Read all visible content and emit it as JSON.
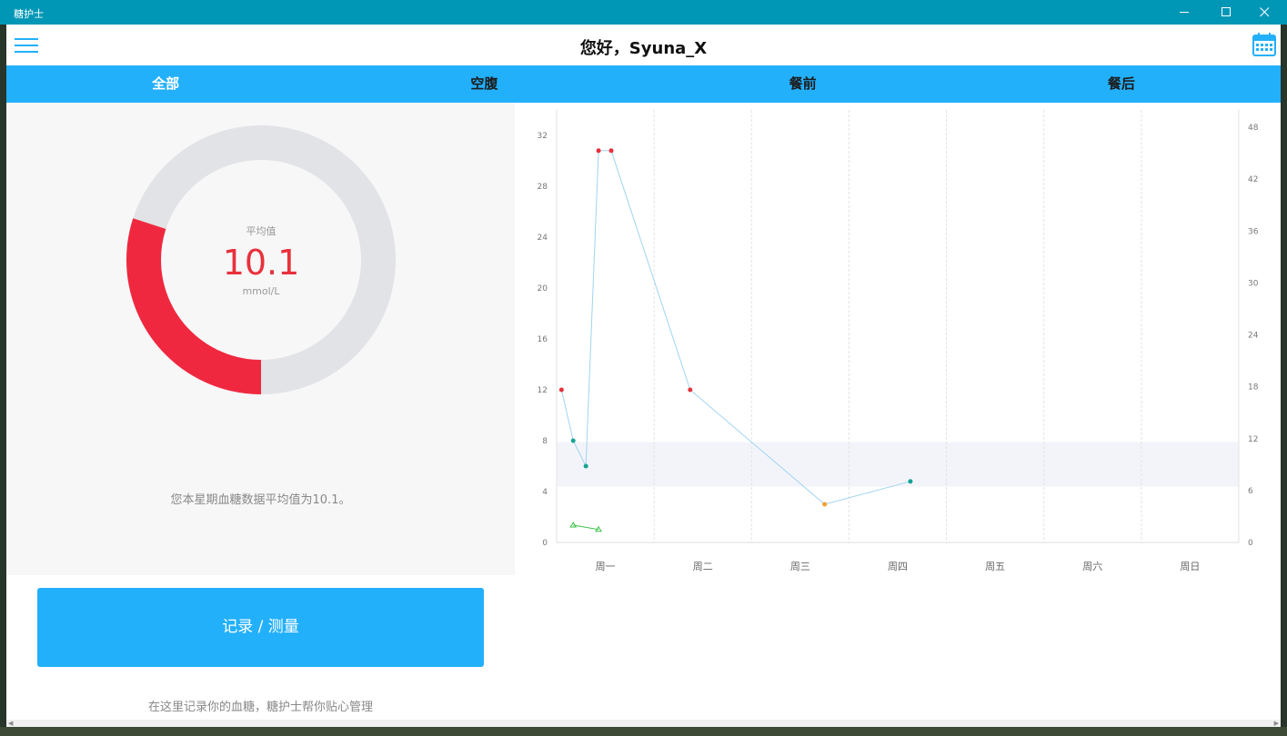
{
  "window": {
    "title": "糖护士",
    "controls": {
      "minimize_icon": "minimize-icon",
      "maximize_icon": "maximize-icon",
      "close_icon": "close-icon"
    }
  },
  "header": {
    "greeting": "您好，Syuna_X",
    "menu_icon": "hamburger-icon",
    "calendar_icon": "calendar-icon"
  },
  "tabs": [
    {
      "label": "全部",
      "active": true
    },
    {
      "label": "空腹",
      "active": false
    },
    {
      "label": "餐前",
      "active": false
    },
    {
      "label": "餐后",
      "active": false
    }
  ],
  "summary": {
    "label": "平均值",
    "value": "10.1",
    "unit": "mmol/L",
    "progress_fraction": 0.3,
    "text": "您本星期血糖数据平均值为10.1。"
  },
  "actions": {
    "record_label": "记录 / 测量",
    "hint": "在这里记录你的血糖，糖护士帮你贴心管理"
  },
  "colors": {
    "accent": "#23b0fb",
    "titlebar": "#0097b6",
    "donut_value": "#f0283f",
    "donut_track": "#e1e3e6",
    "line": "#a0d4f0",
    "high": "#e8313c",
    "normal": "#16a394",
    "low": "#f0a030",
    "secondary": "#3cc04a",
    "band": "#f3f4fa"
  },
  "chart_data": {
    "type": "line",
    "categories": [
      "周一",
      "周二",
      "周三",
      "周四",
      "周五",
      "周六",
      "周日"
    ],
    "ylim": [
      0,
      34
    ],
    "y_ticks": [
      0,
      4,
      8,
      12,
      16,
      20,
      24,
      28,
      32
    ],
    "y2lim": [
      0,
      50
    ],
    "y2_ticks": [
      0,
      6,
      12,
      18,
      24,
      30,
      36,
      42,
      48
    ],
    "target_band": [
      4.4,
      7.9
    ],
    "series": [
      {
        "values": [
          {
            "x": 0.05,
            "y": 12.0,
            "level": "high"
          },
          {
            "x": 0.17,
            "y": 8.0,
            "level": "normal"
          },
          {
            "x": 0.3,
            "y": 6.0,
            "level": "normal"
          },
          {
            "x": 0.43,
            "y": 30.8,
            "level": "high"
          },
          {
            "x": 0.56,
            "y": 30.8,
            "level": "high"
          },
          {
            "x": 1.37,
            "y": 12.0,
            "level": "high"
          },
          {
            "x": 2.75,
            "y": 3.0,
            "level": "low"
          },
          {
            "x": 3.63,
            "y": 4.8,
            "level": "normal"
          }
        ]
      },
      {
        "values": [
          {
            "x": 0.17,
            "y2": 2.0
          },
          {
            "x": 0.43,
            "y2": 1.5
          }
        ]
      }
    ],
    "grid": true
  }
}
